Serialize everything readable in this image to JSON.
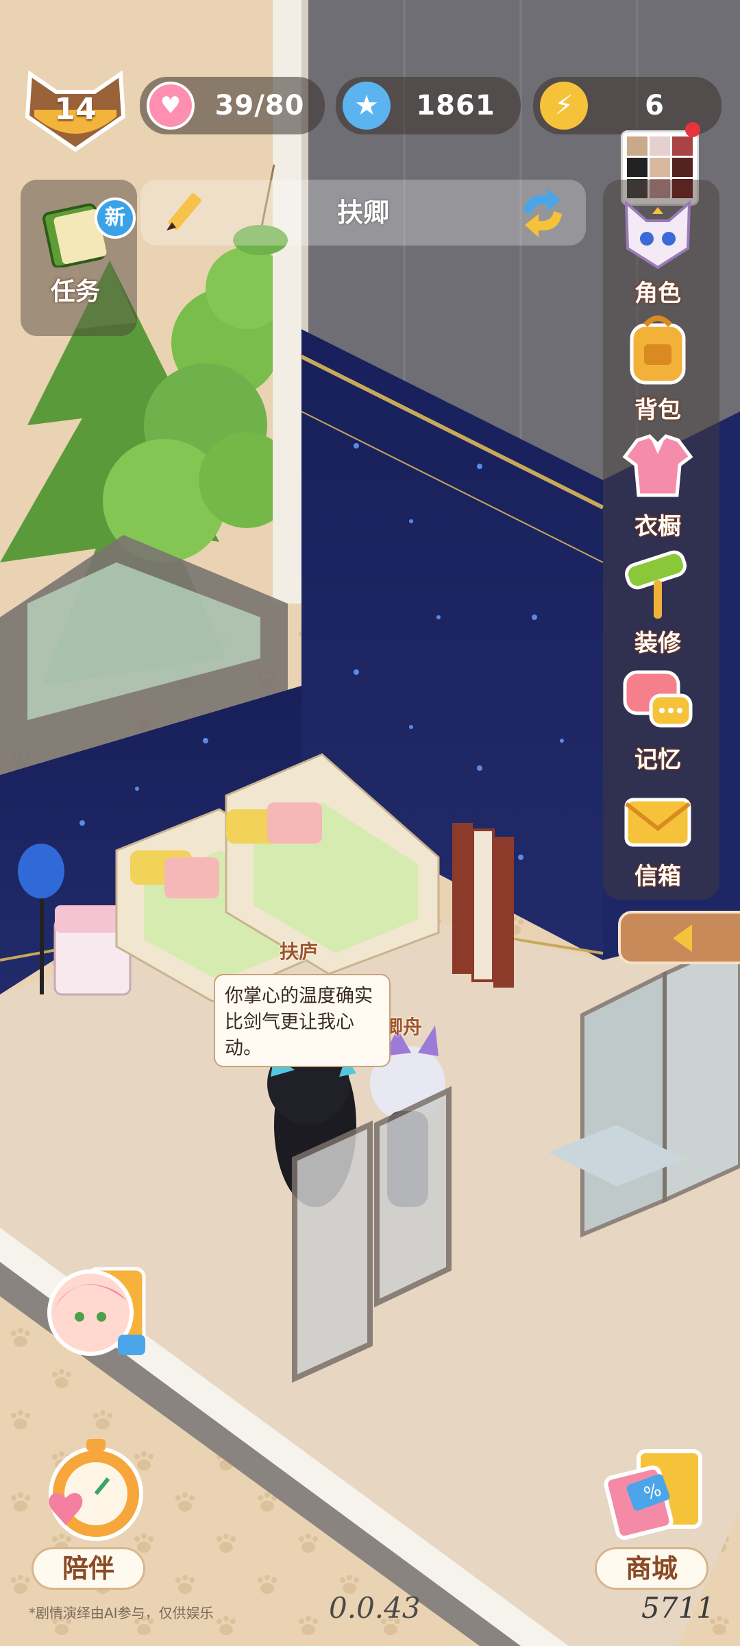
{
  "hud": {
    "level": "14",
    "hearts": "39/80",
    "stars": "1861",
    "energy": "6"
  },
  "task": {
    "label": "任务",
    "new_badge": "新"
  },
  "name_bar": {
    "name": "扶卿"
  },
  "side_menu": {
    "items": [
      {
        "label": "角色",
        "icon": "cat-character-icon"
      },
      {
        "label": "背包",
        "icon": "backpack-icon"
      },
      {
        "label": "衣橱",
        "icon": "shirt-icon"
      },
      {
        "label": "装修",
        "icon": "paint-roller-icon"
      },
      {
        "label": "记忆",
        "icon": "chat-bubble-icon"
      },
      {
        "label": "信箱",
        "icon": "mail-icon"
      }
    ]
  },
  "scene": {
    "character1_name": "扶庐",
    "character2_name": "卿舟",
    "speech": "你掌心的温度确实比剑气更让我心动。"
  },
  "bottom": {
    "companion_label": "陪伴",
    "shop_label": "商城",
    "disclaimer": "*剧情演绎由AI参与，仅供娱乐",
    "version": "0.0.43",
    "user_id": "5711"
  },
  "colors": {
    "wall_night": "#1c2460",
    "floor": "#e6d6c2",
    "bg_tan": "#e9d3b3",
    "accent_orange": "#d9834a"
  }
}
